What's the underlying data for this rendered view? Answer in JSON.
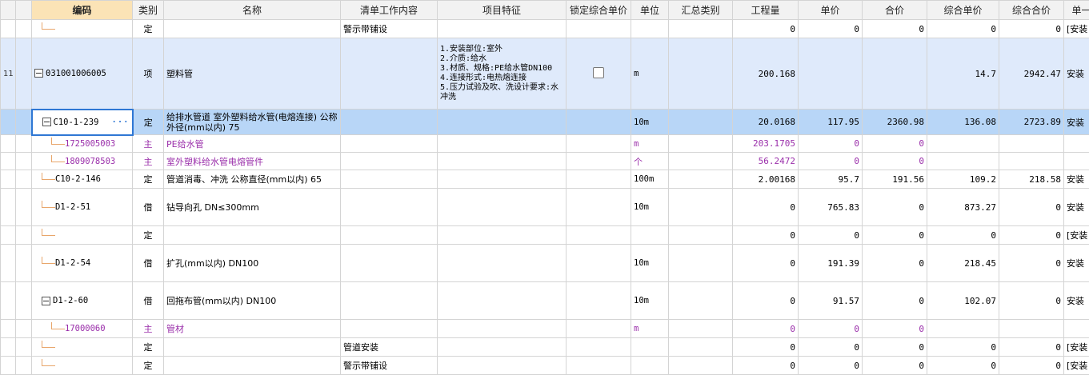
{
  "headers": {
    "code": "编码",
    "type": "类别",
    "name": "名称",
    "work": "清单工作内容",
    "feature": "项目特征",
    "lock": "锁定综合单价",
    "unit": "单位",
    "summary": "汇总类别",
    "qty": "工程量",
    "price": "单价",
    "total": "合价",
    "comp_price": "综合单价",
    "comp_total": "综合合价",
    "extra": "单一"
  },
  "rows": [
    {
      "rowno": "",
      "code": "",
      "type": "定",
      "name": "",
      "work": "警示带铺设",
      "feature": "",
      "unit": "",
      "qty": "0",
      "price": "0",
      "total": "0",
      "comp_price": "0",
      "comp_total": "0",
      "extra": "[安装"
    },
    {
      "rowno": "11",
      "code": "031001006005",
      "type": "项",
      "name": "塑料管",
      "work": "",
      "feature": "1.安装部位:室外\n2.介质:给水\n3.材质、规格:PE给水管DN100\n4.连接形式:电热熔连接\n5.压力试验及吹、洗设计要求:水冲洗",
      "unit": "m",
      "qty": "200.168",
      "price": "",
      "total": "",
      "comp_price": "14.7",
      "comp_total": "2942.47",
      "extra": "安装"
    },
    {
      "rowno": "",
      "code": "C10-1-239",
      "type": "定",
      "name": "给排水管道 室外塑料给水管(电熔连接) 公称外径(mm以内) 75",
      "work": "",
      "feature": "",
      "unit": "10m",
      "qty": "20.0168",
      "price": "117.95",
      "total": "2360.98",
      "comp_price": "136.08",
      "comp_total": "2723.89",
      "extra": "安装"
    },
    {
      "rowno": "",
      "code": "1725005003",
      "type": "主",
      "name": "PE给水管",
      "work": "",
      "feature": "",
      "unit": "m",
      "qty": "203.1705",
      "price": "0",
      "total": "0",
      "comp_price": "",
      "comp_total": "",
      "extra": ""
    },
    {
      "rowno": "",
      "code": "1809078503",
      "type": "主",
      "name": "室外塑料给水管电熔管件",
      "work": "",
      "feature": "",
      "unit": "个",
      "qty": "56.2472",
      "price": "0",
      "total": "0",
      "comp_price": "",
      "comp_total": "",
      "extra": ""
    },
    {
      "rowno": "",
      "code": "C10-2-146",
      "type": "定",
      "name": "管道消毒、冲洗 公称直径(mm以内) 65",
      "work": "",
      "feature": "",
      "unit": "100m",
      "qty": "2.00168",
      "price": "95.7",
      "total": "191.56",
      "comp_price": "109.2",
      "comp_total": "218.58",
      "extra": "安装"
    },
    {
      "rowno": "",
      "code": "D1-2-51",
      "type": "借",
      "name": "钻导向孔 DN≤300mm",
      "work": "",
      "feature": "",
      "unit": "10m",
      "qty": "0",
      "price": "765.83",
      "total": "0",
      "comp_price": "873.27",
      "comp_total": "0",
      "extra": "安装"
    },
    {
      "rowno": "",
      "code": "",
      "type": "定",
      "name": "",
      "work": "",
      "feature": "",
      "unit": "",
      "qty": "0",
      "price": "0",
      "total": "0",
      "comp_price": "0",
      "comp_total": "0",
      "extra": "[安装"
    },
    {
      "rowno": "",
      "code": "D1-2-54",
      "type": "借",
      "name": "扩孔(mm以内) DN100",
      "work": "",
      "feature": "",
      "unit": "10m",
      "qty": "0",
      "price": "191.39",
      "total": "0",
      "comp_price": "218.45",
      "comp_total": "0",
      "extra": "安装"
    },
    {
      "rowno": "",
      "code": "D1-2-60",
      "type": "借",
      "name": "回拖布管(mm以内) DN100",
      "work": "",
      "feature": "",
      "unit": "10m",
      "qty": "0",
      "price": "91.57",
      "total": "0",
      "comp_price": "102.07",
      "comp_total": "0",
      "extra": "安装"
    },
    {
      "rowno": "",
      "code": "17000060",
      "type": "主",
      "name": "管材",
      "work": "",
      "feature": "",
      "unit": "m",
      "qty": "0",
      "price": "0",
      "total": "0",
      "comp_price": "",
      "comp_total": "",
      "extra": ""
    },
    {
      "rowno": "",
      "code": "",
      "type": "定",
      "name": "",
      "work": "管道安装",
      "feature": "",
      "unit": "",
      "qty": "0",
      "price": "0",
      "total": "0",
      "comp_price": "0",
      "comp_total": "0",
      "extra": "[安装"
    },
    {
      "rowno": "",
      "code": "",
      "type": "定",
      "name": "",
      "work": "警示带铺设",
      "feature": "",
      "unit": "",
      "qty": "0",
      "price": "0",
      "total": "0",
      "comp_price": "0",
      "comp_total": "0",
      "extra": "[安装"
    }
  ],
  "colors": {
    "header_bg": "#f2f2f2",
    "code_header_bg": "#fbe3b6",
    "item_row": "#dfeafb",
    "selected_row": "#b8d6f7",
    "selection_border": "#2f77d4",
    "material_text": "#9a2eaa",
    "tree_line": "#e8a66b"
  },
  "icons": {
    "expander": "collapse-minus-icon",
    "more": "ellipsis-icon",
    "tree": "tree-connector-icon"
  }
}
